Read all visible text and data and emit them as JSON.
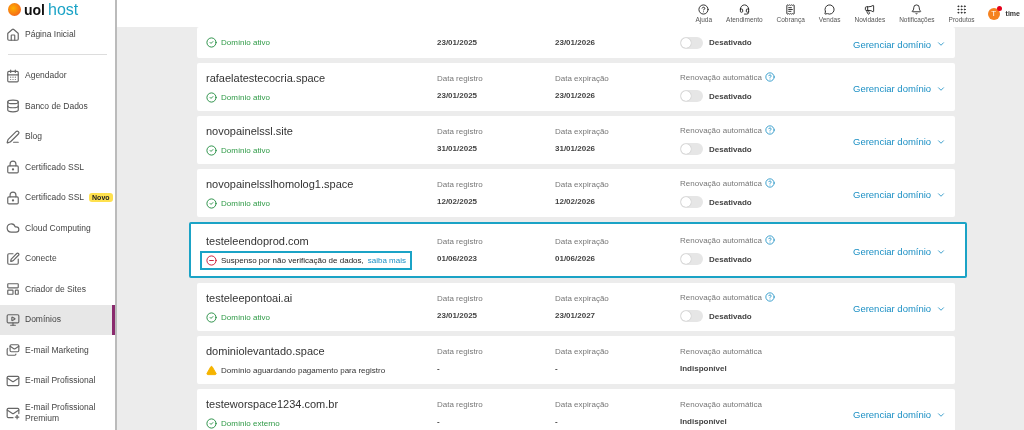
{
  "logo": {
    "brand": "uol",
    "product": "host"
  },
  "header": {
    "items": [
      {
        "kind": "help",
        "label": "Ajuda"
      },
      {
        "kind": "support",
        "label": "Atendimento"
      },
      {
        "kind": "billing",
        "label": "Cobrança"
      },
      {
        "kind": "sales",
        "label": "Vendas"
      },
      {
        "kind": "news",
        "label": "Novidades"
      },
      {
        "kind": "notifications",
        "label": "Notificações"
      },
      {
        "kind": "products",
        "label": "Produtos"
      }
    ],
    "user": {
      "initial": "T",
      "name": "time",
      "has_alert": true
    }
  },
  "sidebar": {
    "items": [
      {
        "kind": "home",
        "label": "Página Inicial",
        "selected": false
      },
      {
        "kind": "scheduler",
        "label": "Agendador",
        "selected": false
      },
      {
        "kind": "database",
        "label": "Banco de Dados",
        "selected": false
      },
      {
        "kind": "blog",
        "label": "Blog",
        "selected": false
      },
      {
        "kind": "ssl",
        "label": "Certificado SSL",
        "selected": false
      },
      {
        "kind": "ssl",
        "label": "Certificado SSL",
        "badge": "Novo",
        "selected": false
      },
      {
        "kind": "cloud",
        "label": "Cloud Computing",
        "selected": false
      },
      {
        "kind": "connect",
        "label": "Conecte",
        "selected": false
      },
      {
        "kind": "builder",
        "label": "Criador de Sites",
        "selected": false
      },
      {
        "kind": "domains",
        "label": "Domínios",
        "selected": true
      },
      {
        "kind": "marketing",
        "label": "E-mail Marketing",
        "selected": false
      },
      {
        "kind": "email",
        "label": "E-mail Profissional",
        "selected": false
      },
      {
        "kind": "email_premium",
        "label": "E-mail Profissional Premium",
        "selected": false
      }
    ]
  },
  "domains": [
    {
      "highlighted": false,
      "status": {
        "kind": "active",
        "text": "Domínio ativo"
      },
      "registered": {
        "value": "23/01/2025"
      },
      "expires": {
        "value": "23/01/2026"
      },
      "renewal": {
        "kind": "toggle",
        "on": false,
        "value": "Desativado"
      },
      "manage": "Gerenciar domínio"
    },
    {
      "name": "rafaelatestecocria.space",
      "highlighted": false,
      "status": {
        "kind": "active",
        "text": "Domínio ativo"
      },
      "registered": {
        "label": "Data registro",
        "value": "23/01/2025"
      },
      "expires": {
        "label": "Data expiração",
        "value": "23/01/2026"
      },
      "renewal": {
        "kind": "toggle",
        "label": "Renovação automática",
        "on": false,
        "value": "Desativado"
      },
      "manage": "Gerenciar domínio"
    },
    {
      "name": "novopainelssl.site",
      "highlighted": false,
      "status": {
        "kind": "active",
        "text": "Domínio ativo"
      },
      "registered": {
        "label": "Data registro",
        "value": "31/01/2025"
      },
      "expires": {
        "label": "Data expiração",
        "value": "31/01/2026"
      },
      "renewal": {
        "kind": "toggle",
        "label": "Renovação automática",
        "on": false,
        "value": "Desativado"
      },
      "manage": "Gerenciar domínio"
    },
    {
      "name": "novopainelsslhomolog1.space",
      "highlighted": false,
      "status": {
        "kind": "active",
        "text": "Domínio ativo"
      },
      "registered": {
        "label": "Data registro",
        "value": "12/02/2025"
      },
      "expires": {
        "label": "Data expiração",
        "value": "12/02/2026"
      },
      "renewal": {
        "kind": "toggle",
        "label": "Renovação automática",
        "on": false,
        "value": "Desativado"
      },
      "manage": "Gerenciar domínio"
    },
    {
      "name": "testeleendoprod.com",
      "highlighted": true,
      "status": {
        "kind": "suspended",
        "text": "Suspenso por não verificação de dados,",
        "link": "saiba mais"
      },
      "registered": {
        "label": "Data registro",
        "value": "01/06/2023"
      },
      "expires": {
        "label": "Data expiração",
        "value": "01/06/2026"
      },
      "renewal": {
        "kind": "toggle",
        "label": "Renovação automática",
        "on": false,
        "value": "Desativado"
      },
      "manage": "Gerenciar domínio"
    },
    {
      "name": "testeleepontoai.ai",
      "highlighted": false,
      "status": {
        "kind": "active",
        "text": "Domínio ativo"
      },
      "registered": {
        "label": "Data registro",
        "value": "23/01/2025"
      },
      "expires": {
        "label": "Data expiração",
        "value": "23/01/2027"
      },
      "renewal": {
        "kind": "toggle",
        "label": "Renovação automática",
        "on": false,
        "value": "Desativado"
      },
      "manage": "Gerenciar domínio"
    },
    {
      "name": "dominiolevantado.space",
      "highlighted": false,
      "status": {
        "kind": "pending",
        "text": "Domínio aguardando pagamento para registro"
      },
      "registered": {
        "label": "Data registro",
        "value": "-"
      },
      "expires": {
        "label": "Data expiração",
        "value": "-"
      },
      "renewal": {
        "kind": "unavailable",
        "label": "Renovação automática",
        "value": "Indisponível"
      }
    },
    {
      "name": "testeworspace1234.com.br",
      "highlighted": false,
      "status": {
        "kind": "external",
        "text": "Domínio externo"
      },
      "registered": {
        "label": "Data registro",
        "value": "-"
      },
      "expires": {
        "label": "Data expiração",
        "value": "-"
      },
      "renewal": {
        "kind": "unavailable",
        "label": "Renovação automática",
        "value": "Indisponível"
      },
      "manage": "Gerenciar domínio"
    }
  ]
}
